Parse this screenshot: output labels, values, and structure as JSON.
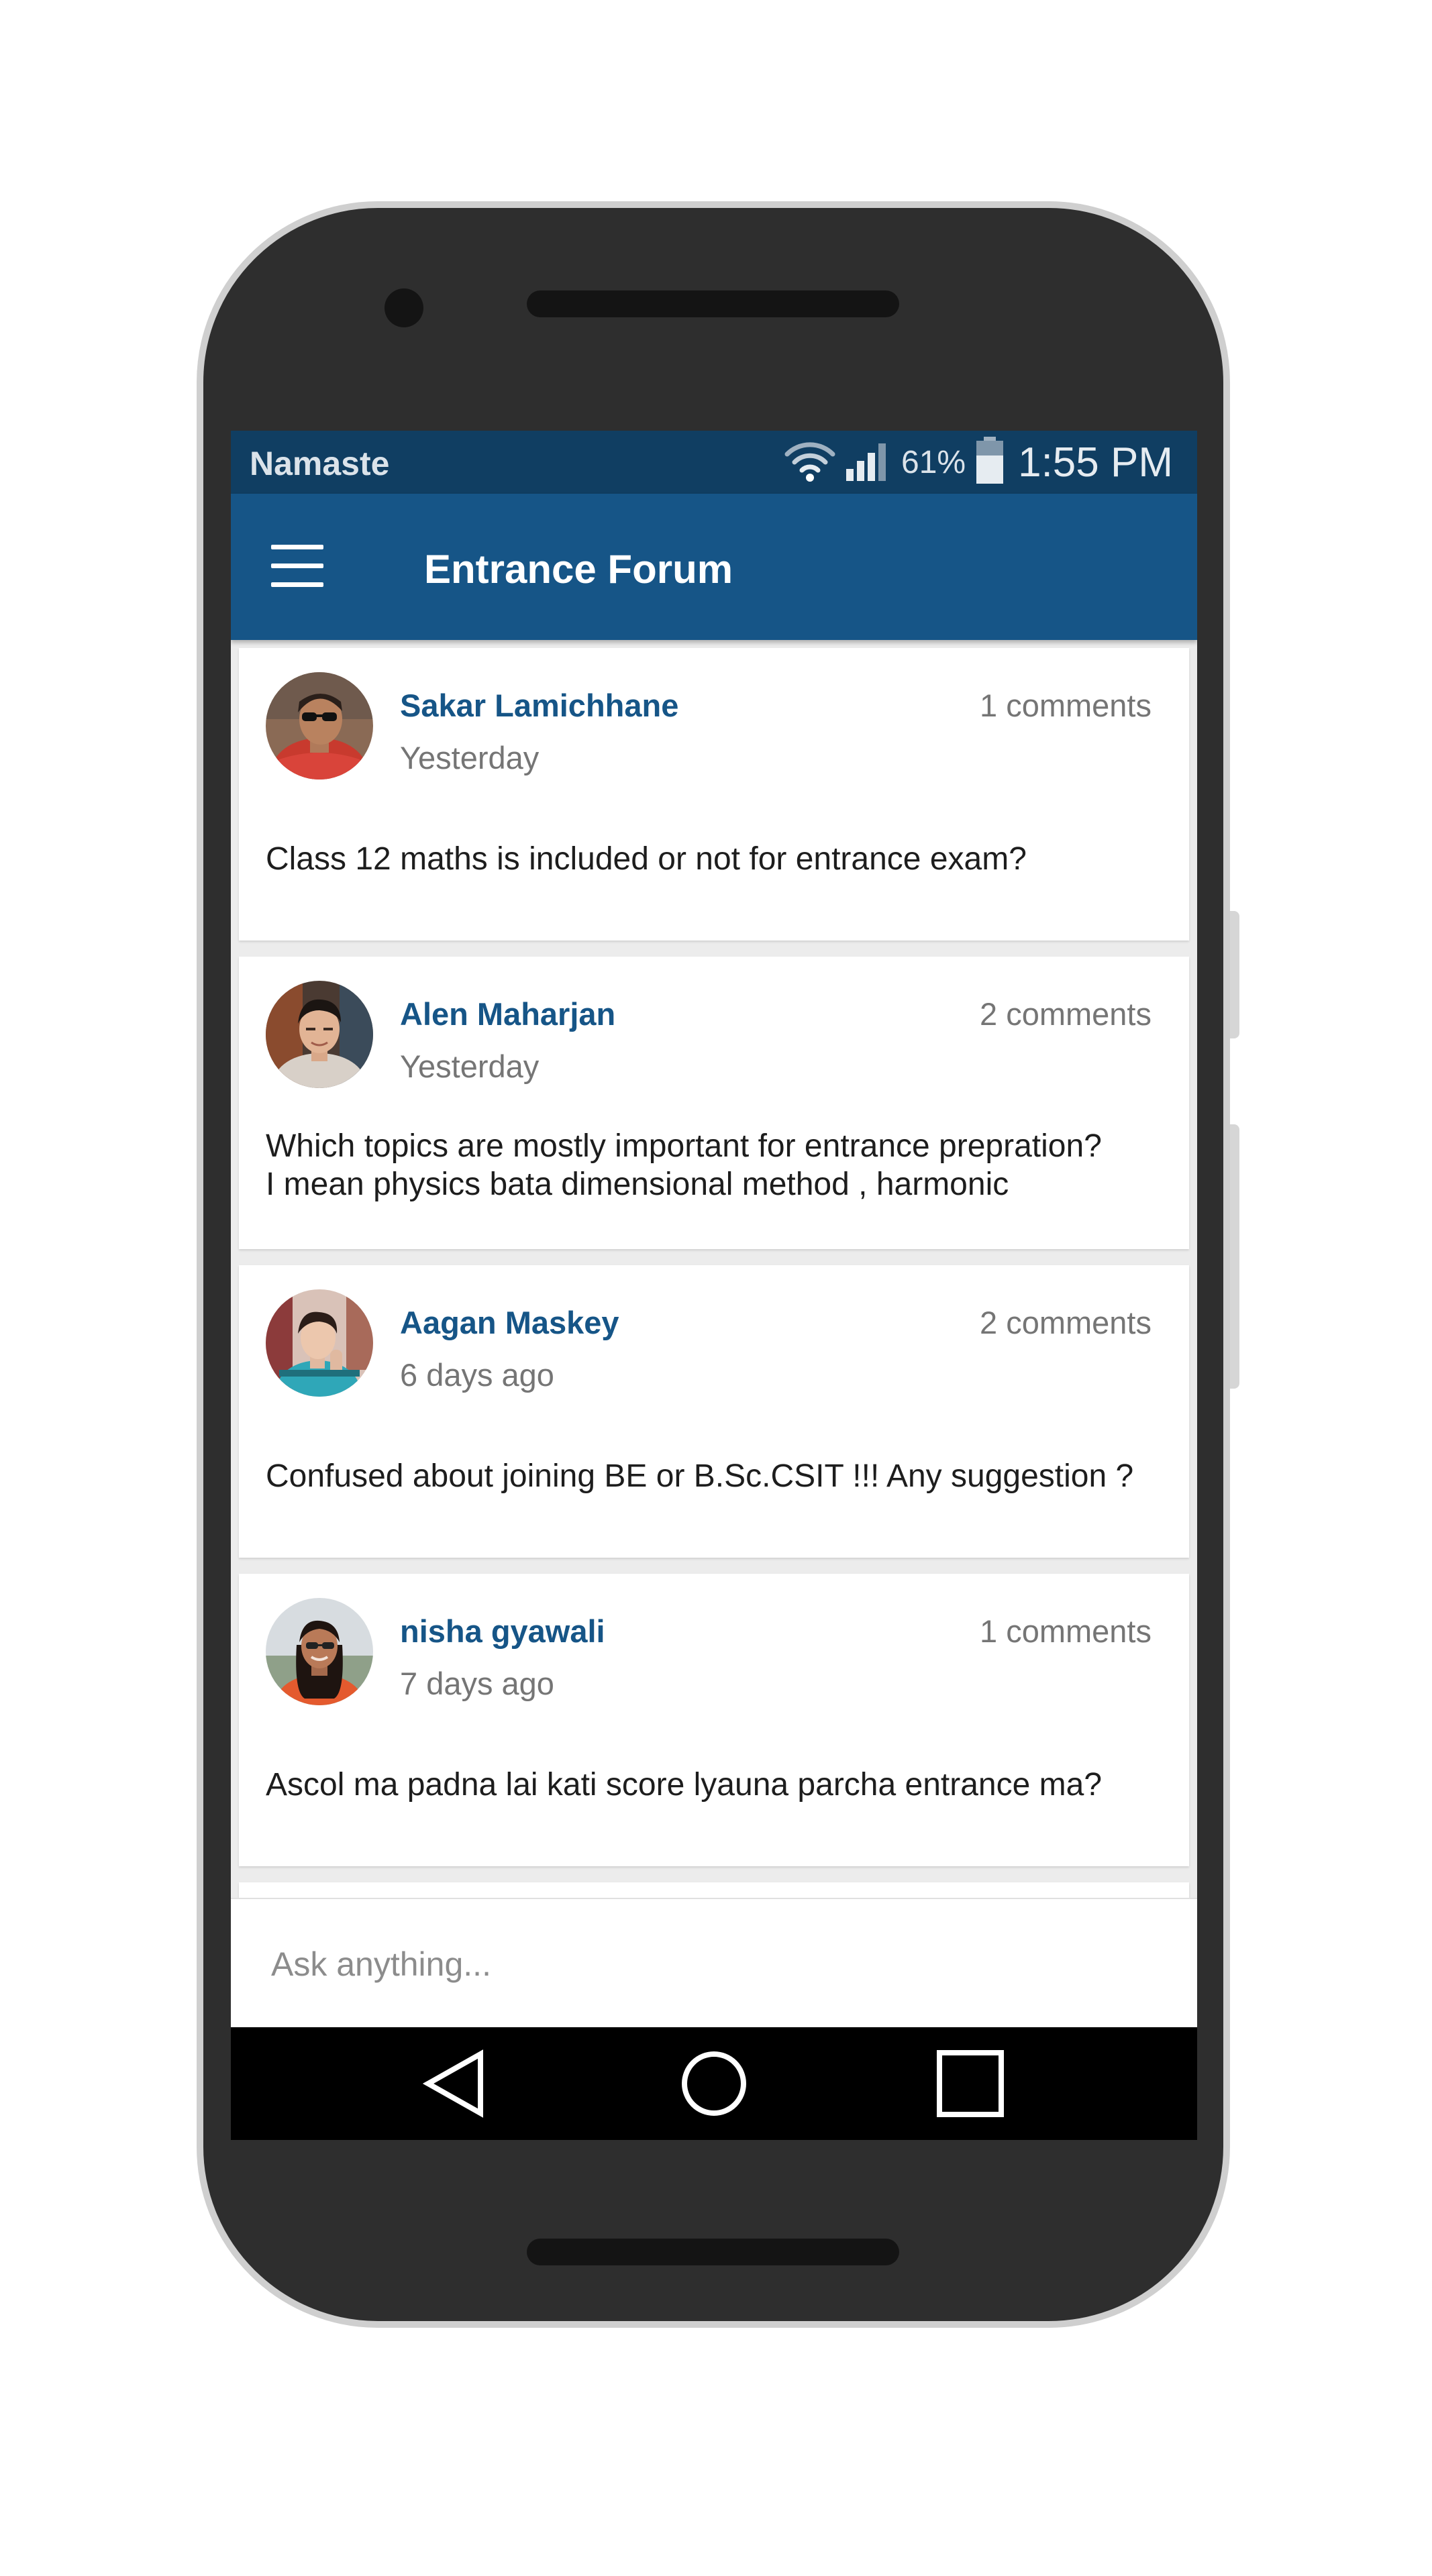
{
  "status_bar": {
    "carrier": "Namaste",
    "battery_percent": "61%",
    "time": "1:55 PM",
    "icons": [
      "wifi-icon",
      "signal-icon",
      "battery-icon"
    ]
  },
  "app_bar": {
    "title": "Entrance Forum",
    "menu_icon": "hamburger-menu-icon",
    "color": "#165587"
  },
  "posts": [
    {
      "author": "Sakar Lamichhane",
      "time": "Yesterday",
      "comments": "1 comments",
      "question": "Class 12 maths is included or not for entrance exam?"
    },
    {
      "author": "Alen Maharjan",
      "time": "Yesterday",
      "comments": "2 comments",
      "question_line1": "Which topics are mostly important for entrance prepration?",
      "question_line2": "I mean physics bata dimensional method , harmonic"
    },
    {
      "author": "Aagan Maskey",
      "time": "6 days ago",
      "comments": "2 comments",
      "question": "Confused about joining BE or B.Sc.CSIT !!! Any suggestion ?"
    },
    {
      "author": "nisha gyawali",
      "time": "7 days ago",
      "comments": "1 comments",
      "question": "Ascol ma padna lai kati score lyauna parcha entrance ma?"
    }
  ],
  "ask": {
    "placeholder": "Ask anything..."
  },
  "nav": {
    "icons": [
      "back-icon",
      "home-icon",
      "recents-icon"
    ]
  }
}
